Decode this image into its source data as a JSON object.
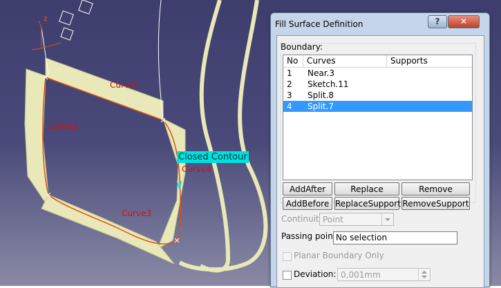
{
  "viewport": {
    "axis_label": "z",
    "curve_labels": [
      "Curve1",
      "Curve2",
      "Curve3",
      "Curve4"
    ],
    "contour_tag": "Closed Contour"
  },
  "dialog": {
    "title": "Fill Surface Definition",
    "help_label": "?",
    "close_label": "✕",
    "boundary_label": "Boundary:",
    "columns": [
      "No",
      "Curves",
      "Supports"
    ],
    "rows": [
      {
        "no": "1",
        "curve": "Near.3",
        "support": ""
      },
      {
        "no": "2",
        "curve": "Sketch.11",
        "support": ""
      },
      {
        "no": "3",
        "curve": "Split.8",
        "support": ""
      },
      {
        "no": "4",
        "curve": "Split.7",
        "support": ""
      }
    ],
    "selected_row": 4,
    "buttons": {
      "add_after": "AddAfter",
      "replace": "Replace",
      "remove": "Remove",
      "add_before": "AddBefore",
      "replace_support": "ReplaceSupport",
      "remove_support": "RemoveSupport"
    },
    "continuity_label": "Continuity:",
    "continuity_value": "Point",
    "passing_point_label": "Passing point:",
    "passing_point_value": "No selection",
    "planar_boundary_label": "Planar Boundary Only",
    "deviation_label": "Deviation:",
    "deviation_value": "0,001mm"
  },
  "colors": {
    "surface": "#e8e8b8",
    "curve": "#e05010",
    "label_red": "#d01010",
    "contour_cyan": "#00e0e0",
    "selection": "#3399ff"
  }
}
